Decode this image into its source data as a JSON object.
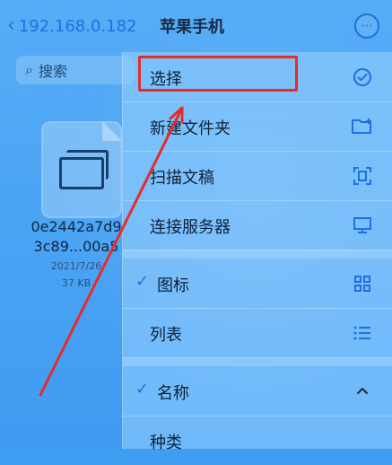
{
  "nav": {
    "back_label": "192.168.0.182",
    "title": "苹果手机",
    "more_symbol": "⋯"
  },
  "search": {
    "placeholder": "搜索"
  },
  "file": {
    "name_line1": "0e2442a7d9",
    "name_line2": "3c89...00a5",
    "date": "2021/7/26",
    "size": "37 KB"
  },
  "menu": {
    "items": [
      {
        "label": "选择",
        "icon": "check-circle-icon",
        "icon_glyph": "✓"
      },
      {
        "label": "新建文件夹",
        "icon": "new-folder-icon",
        "icon_glyph": "▭"
      },
      {
        "label": "扫描文稿",
        "icon": "scan-icon",
        "icon_glyph": "⧈"
      },
      {
        "label": "连接服务器",
        "icon": "monitor-icon",
        "icon_glyph": "▭"
      },
      {
        "label": "图标",
        "icon": "grid-icon",
        "icon_glyph": "▦",
        "checked": true
      },
      {
        "label": "列表",
        "icon": "list-icon",
        "icon_glyph": "☰"
      },
      {
        "label": "名称",
        "icon": "chevron-up-icon",
        "icon_glyph": "^",
        "checked": true
      },
      {
        "label": "种类"
      }
    ]
  },
  "annotations": {
    "highlight_color": "#e62b2b"
  }
}
